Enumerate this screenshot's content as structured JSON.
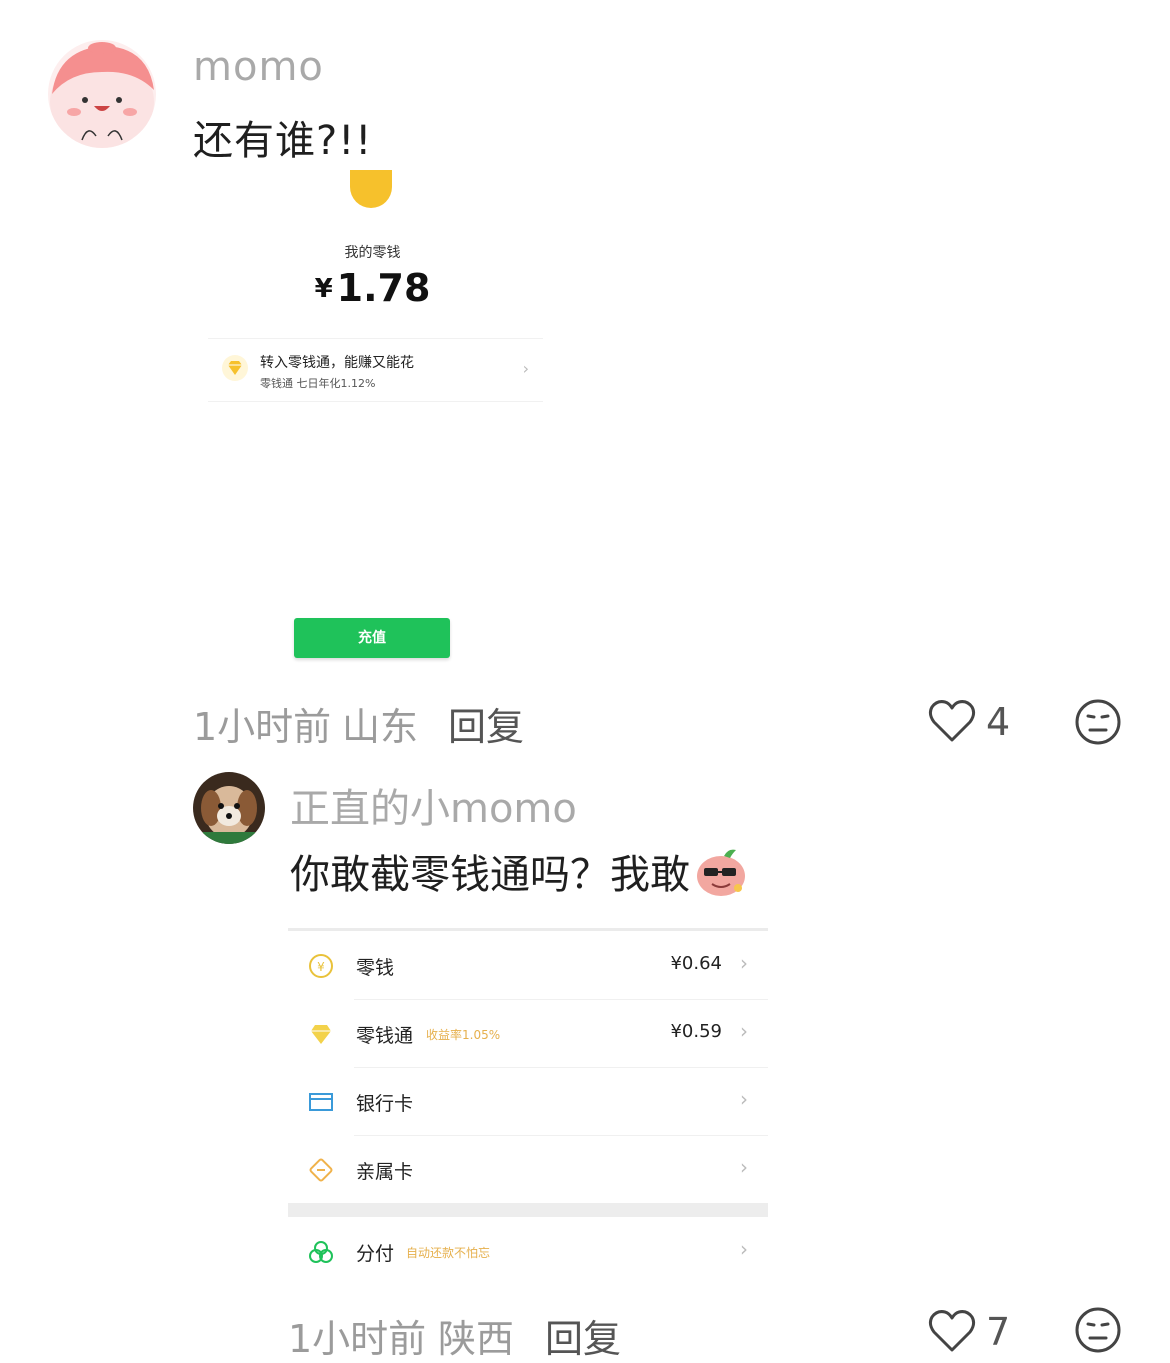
{
  "comment1": {
    "username": "momo",
    "text": "还有谁?!!",
    "time": "1小时前",
    "location": "山东",
    "reply_label": "回复",
    "likes": "4",
    "screenshot": {
      "label": "我的零钱",
      "currency": "¥",
      "amount": "1.78",
      "promo_title": "转入零钱通，能赚又能花",
      "promo_sub": "零钱通 七日年化1.12%",
      "button": "充值"
    }
  },
  "comment2": {
    "username": "正直的小momo",
    "text": "你敢截零钱通吗？我敢",
    "time": "1小时前",
    "location": "陕西",
    "reply_label": "回复",
    "likes": "7",
    "screenshot": {
      "rows": [
        {
          "label": "零钱",
          "tag": "",
          "value": "¥0.64",
          "icon": "yuan-coin-icon"
        },
        {
          "label": "零钱通",
          "tag": "收益率1.05%",
          "value": "¥0.59",
          "icon": "diamond-icon"
        },
        {
          "label": "银行卡",
          "tag": "",
          "value": "",
          "icon": "bank-card-icon"
        },
        {
          "label": "亲属卡",
          "tag": "",
          "value": "",
          "icon": "family-card-icon"
        },
        {
          "label": "分付",
          "tag": "自动还款不怕忘",
          "value": "",
          "icon": "fenfu-icon"
        }
      ]
    }
  },
  "colors": {
    "accent_green": "#1fc25a",
    "coin_yellow": "#f6c12c",
    "tag_gold": "#e6b04d",
    "muted_text": "#9b9b9b"
  }
}
